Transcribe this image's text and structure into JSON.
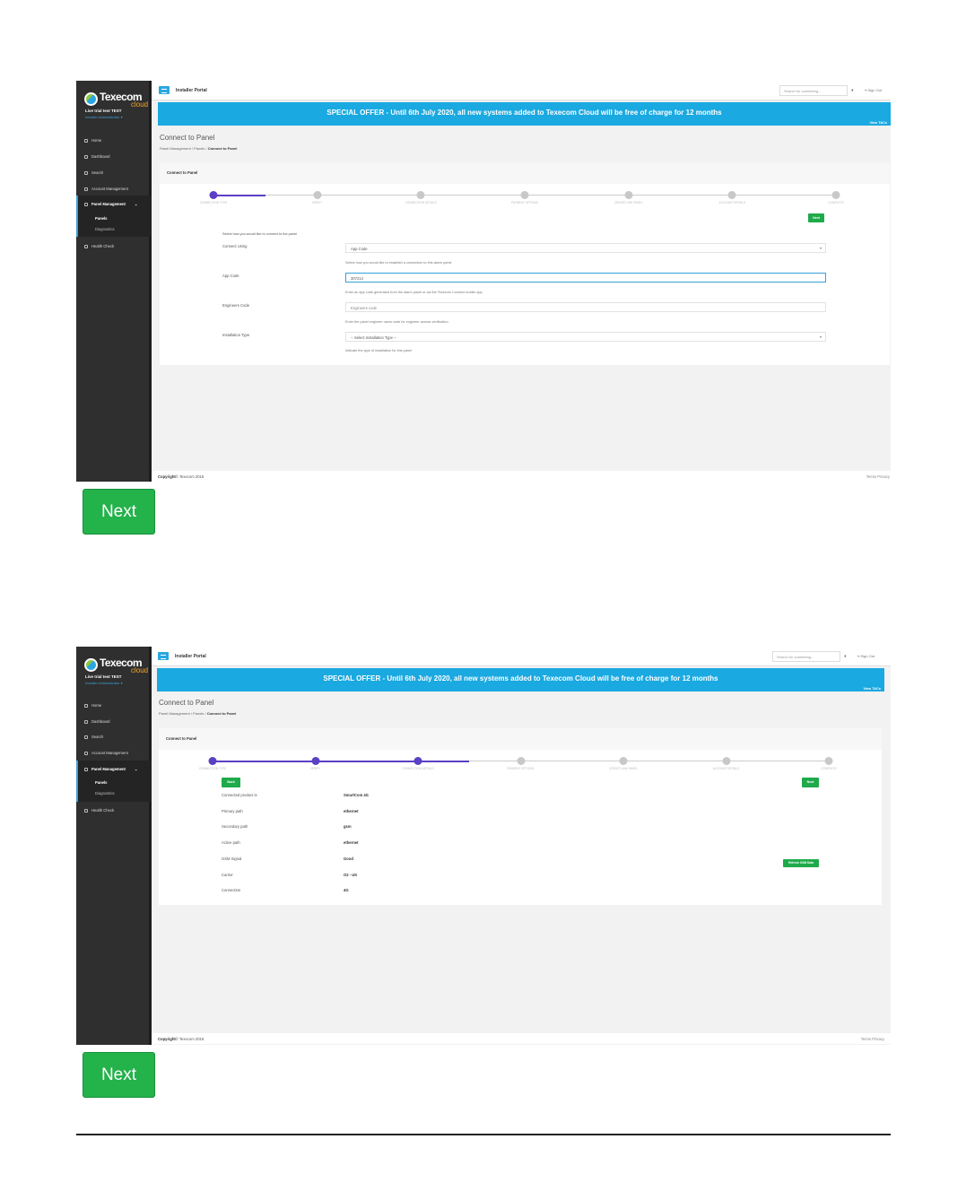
{
  "colors": {
    "accent_blue": "#1aa9e1",
    "stepper_active": "#5b3fc4",
    "button_green": "#1faa4b",
    "sidebar": "#2f2f2f"
  },
  "shot1": {
    "logo": {
      "name": "Texecom",
      "sub": "cloud"
    },
    "user": {
      "name": "Live trial test TEST",
      "role": "Installer Administrator ▾"
    },
    "nav": {
      "home": "Home",
      "dashboard": "Dashboard",
      "search": "Search",
      "account": "Account Management",
      "panel_mgmt": "Panel Management",
      "panels": "Panels",
      "diagnostics": "Diagnostics",
      "health": "Health Check"
    },
    "topbar": {
      "title": "Installer Portal",
      "search_placeholder": "Search for something...",
      "signout": "Sign Out"
    },
    "offer": {
      "text": "SPECIAL OFFER - Until 6th July 2020, all new systems added to Texecom Cloud will be free of charge for 12 months",
      "link": "View T&Cs"
    },
    "page_title": "Connect to Panel",
    "breadcrumb": {
      "a": "Panel Management",
      "b": "Panels",
      "c": "Connect to Panel",
      "sep": "/"
    },
    "card_title": "Connect to Panel",
    "steps": [
      "CONNECTION TYPE",
      "VERIFY",
      "CONNECTION DETAILS",
      "PAYMENT OPTIONS",
      "CREATE LINK PANEL",
      "ACCOUNT DETAILS",
      "COMPLETE"
    ],
    "next_label": "Next",
    "form": {
      "intro": "Select how you would like to connect to the panel",
      "connect_label": "Connect Using",
      "connect_value": "App Code",
      "connect_help": "Select how you would like to establish a connection to this alarm panel",
      "app_label": "App Code",
      "app_value": "307214",
      "app_help": "Enter an app code generated from the alarm panel or via the Texecom Connect mobile app",
      "eng_label": "Engineers Code",
      "eng_placeholder": "Engineers code",
      "eng_help": "Enter the panel engineer users code for engineer access verification",
      "install_label": "Installation Type",
      "install_value": "-- Select Installation Type --",
      "install_help": "Indicate the type of installation for this panel"
    },
    "footer": {
      "copyright": "Copyright",
      "owner": "© Texecom 2018",
      "terms": "Terms",
      "privacy": "Privacy"
    }
  },
  "shot2": {
    "logo": {
      "name": "Texecom",
      "sub": "cloud"
    },
    "user": {
      "name": "Live trial test TEST",
      "role": "Installer Administrator ▾"
    },
    "nav": {
      "home": "Home",
      "dashboard": "Dashboard",
      "search": "Search",
      "account": "Account Management",
      "panel_mgmt": "Panel Management",
      "panels": "Panels",
      "diagnostics": "Diagnostics",
      "health": "Health Check"
    },
    "topbar": {
      "title": "Installer Portal",
      "search_placeholder": "Search for something...",
      "signout": "Sign Out"
    },
    "offer": {
      "text": "SPECIAL OFFER - Until 6th July 2020, all new systems added to Texecom Cloud will be free of charge for 12 months",
      "link": "View T&Cs"
    },
    "page_title": "Connect to Panel",
    "breadcrumb": {
      "a": "Panel Management",
      "b": "Panels",
      "c": "Connect to Panel",
      "sep": "/"
    },
    "card_title": "Connect to Panel",
    "steps": [
      "CONNECTION TYPE",
      "VERIFY",
      "CONNECTION DETAILS",
      "PAYMENT OPTIONS",
      "CREATE LINK PANEL",
      "ACCOUNT DETAILS",
      "COMPLETE"
    ],
    "back_label": "Back",
    "next_label": "Next",
    "refresh_label": "Refresh GSM Data",
    "details": [
      {
        "label": "Connected product is",
        "value": "SmartCom 4G"
      },
      {
        "label": "Primary path",
        "value": "ethernet"
      },
      {
        "label": "Secondary path",
        "value": "gsm"
      },
      {
        "label": "Active path",
        "value": "ethernet"
      },
      {
        "label": "GSM Signal",
        "value": "Good"
      },
      {
        "label": "Carrier",
        "value": "O2 - UK"
      },
      {
        "label": "Connection",
        "value": "4G"
      }
    ],
    "footer": {
      "copyright": "Copyright",
      "owner": "© Texecom 2018",
      "terms": "Terms",
      "privacy": "Privacy"
    }
  },
  "doc_buttons": {
    "next1": "Next",
    "next2": "Next"
  }
}
